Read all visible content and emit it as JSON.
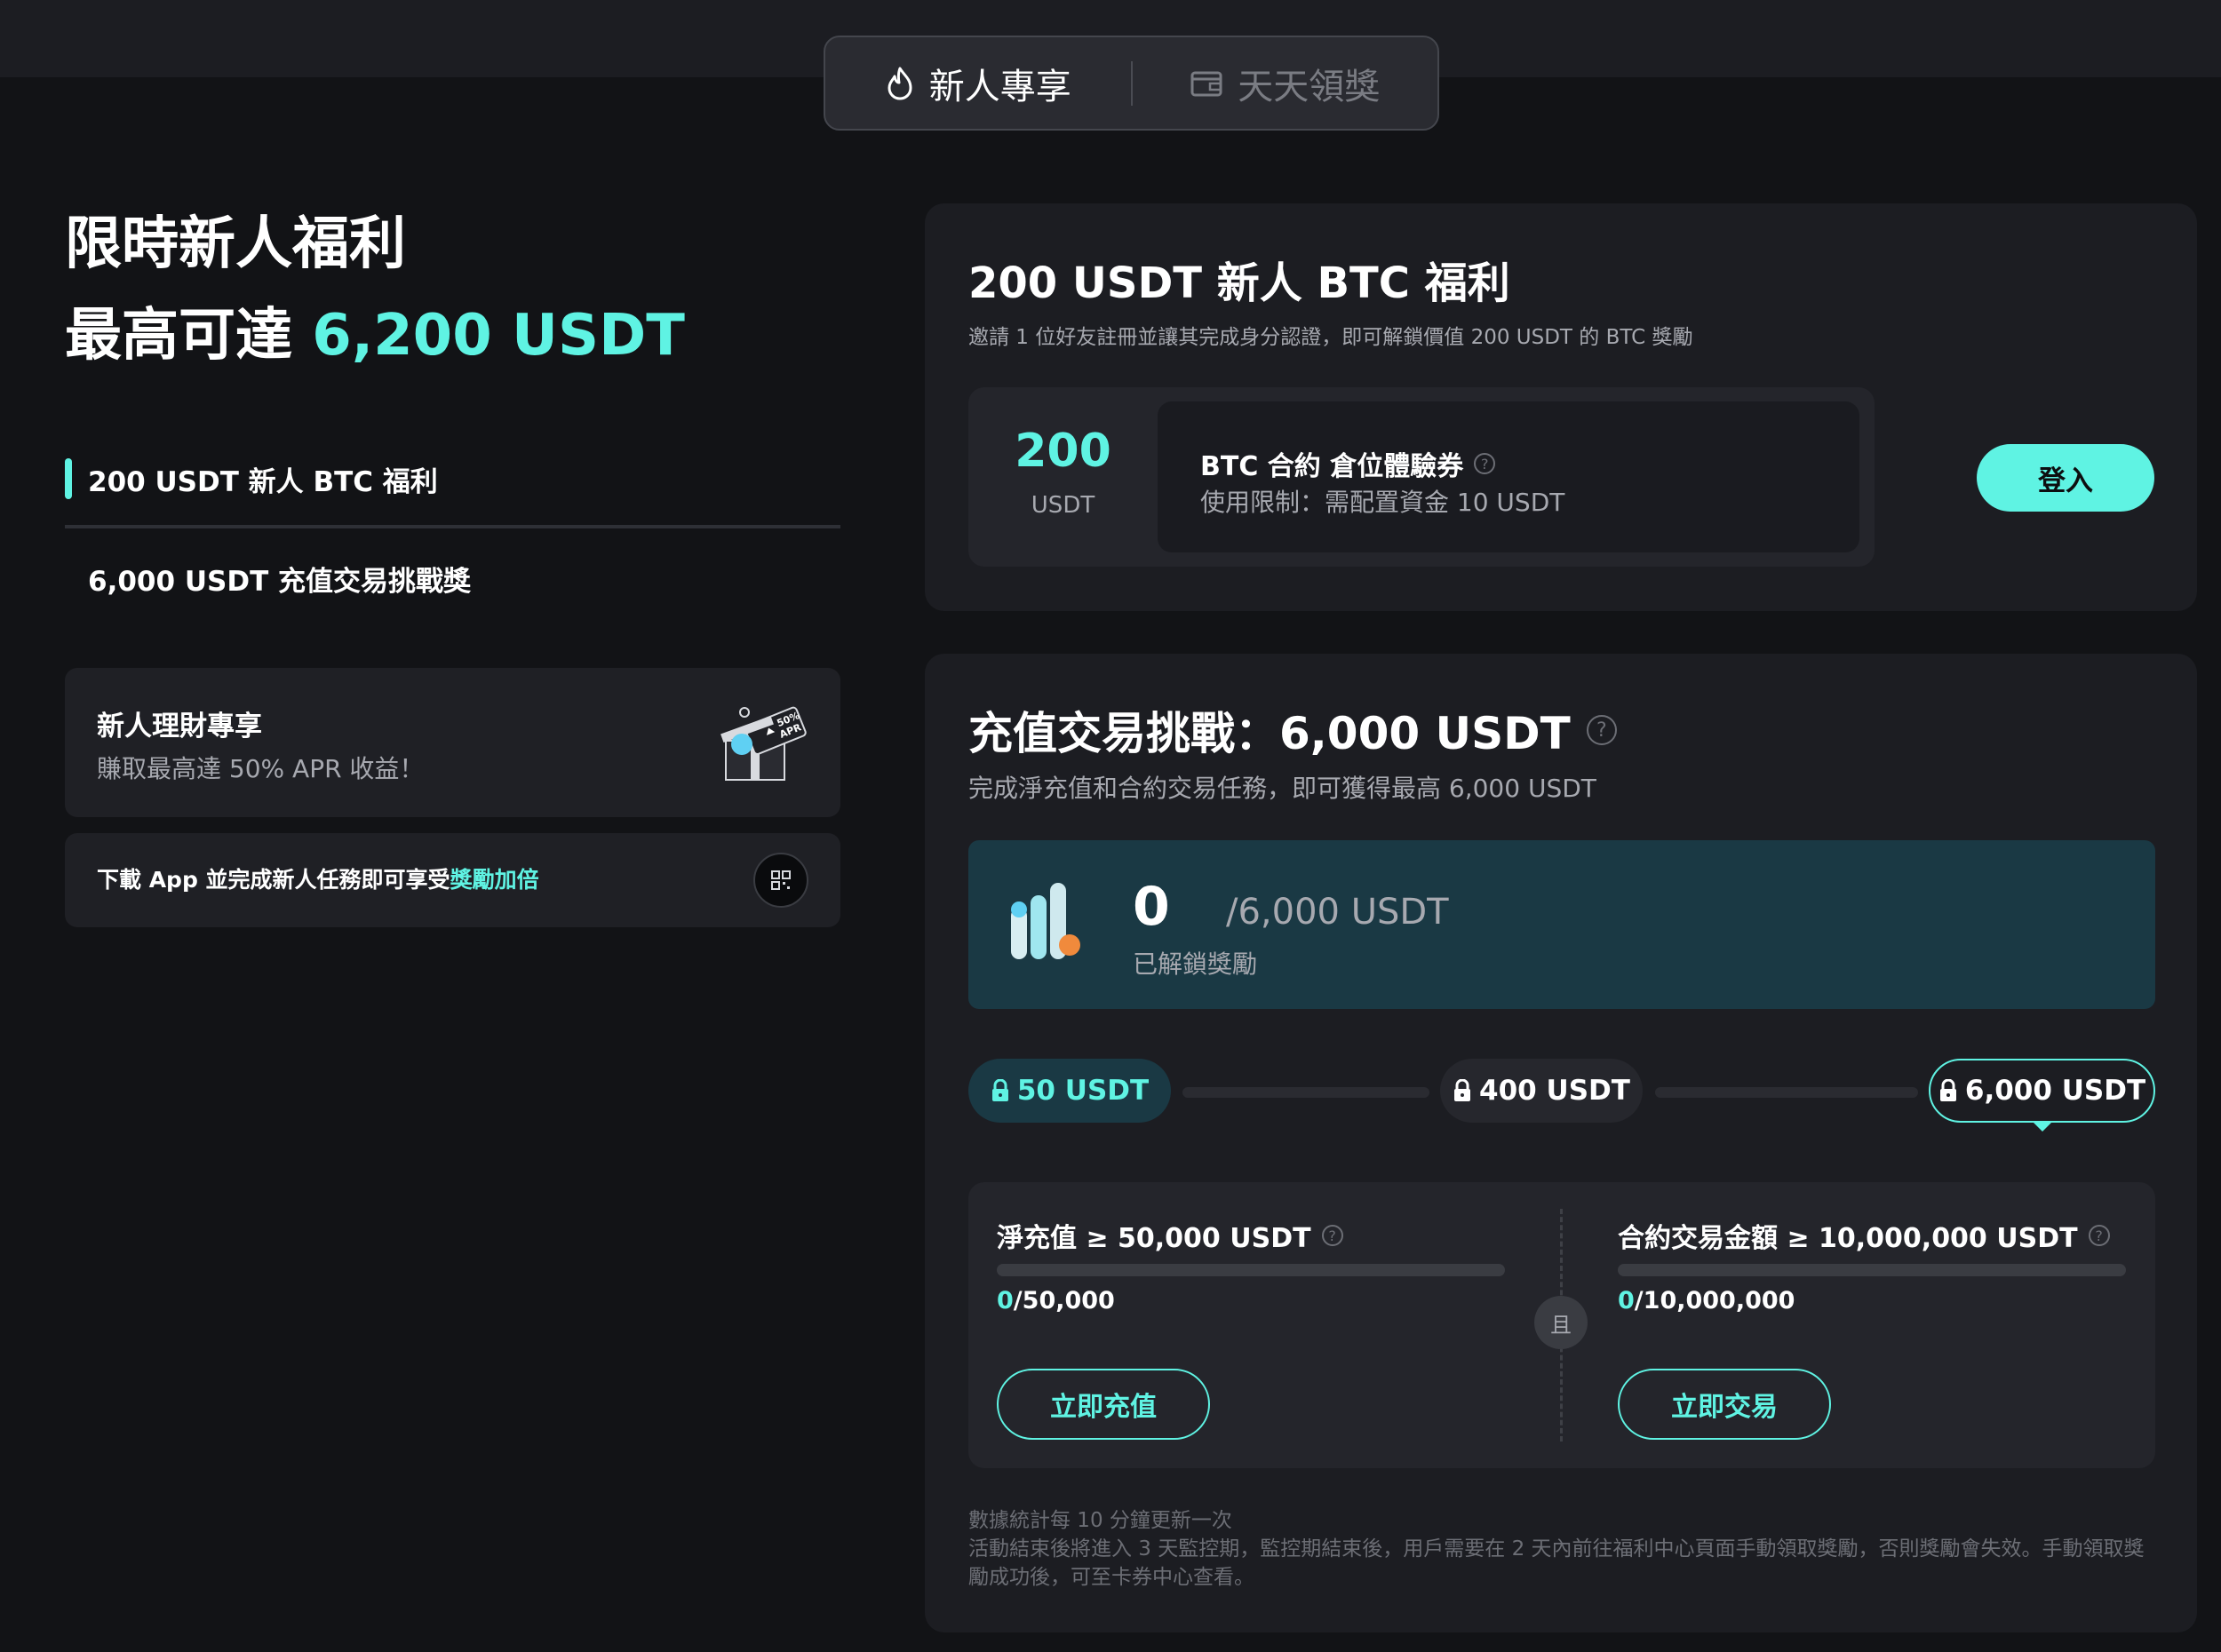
{
  "tabs": [
    {
      "label": "新人專享",
      "icon": "flame-icon"
    },
    {
      "label": "天天領獎",
      "icon": "wallet-icon"
    }
  ],
  "hero": {
    "line1": "限時新人福利",
    "line2_prefix": "最高可達 ",
    "line2_amount": "6,200 USDT"
  },
  "nav": {
    "items": [
      "200 USDT 新人 BTC 福利",
      "6,000 USDT 充值交易挑戰獎"
    ]
  },
  "promo_finance": {
    "title": "新人理財專享",
    "subtitle": "賺取最高達 50% APR 收益！",
    "badge_top": "50%",
    "badge_bottom": "APR"
  },
  "promo_app": {
    "text_prefix": "下載 App 並完成新人任務即可享受",
    "text_accent": "獎勵加倍"
  },
  "btc_card": {
    "title": "200 USDT 新人 BTC 福利",
    "subtitle": "邀請 1 位好友註冊並讓其完成身分認證，即可解鎖價值 200 USDT 的 BTC 獎勵",
    "coupon_amount": "200",
    "coupon_unit": "USDT",
    "coupon_title": "BTC 合約 倉位體驗券",
    "coupon_note": "使用限制：需配置資金 10 USDT",
    "login_label": "登入"
  },
  "challenge": {
    "title": "充值交易挑戰：6,000 USDT",
    "subtitle": "完成淨充值和合約交易任務，即可獲得最高 6,000 USDT",
    "unlocked_value": "0",
    "unlocked_total": "/6,000 USDT",
    "unlocked_label": "已解鎖獎勵",
    "milestones": [
      "50 USDT",
      "400 USDT",
      "6,000 USDT"
    ],
    "tasks": [
      {
        "title": "淨充值 ≥ 50,000 USDT",
        "current": "0",
        "target": "/50,000",
        "progress": 0,
        "button": "立即充值"
      },
      {
        "title": "合約交易金額 ≥ 10,000,000 USDT",
        "current": "0",
        "target": "/10,000,000",
        "progress": 0,
        "button": "立即交易"
      }
    ],
    "and_label": "且",
    "footnote1": "數據統計每 10 分鐘更新一次",
    "footnote2": "活動結束後將進入 3 天監控期，監控期結束後，用戶需要在 2 天內前往福利中心頁面手動領取獎勵，否則獎勵會失效。手動領取獎勵成功後，可至卡券中心查看。"
  },
  "colors": {
    "accent": "#5ff3e3",
    "background": "#121316",
    "card": "#1c1d22"
  }
}
